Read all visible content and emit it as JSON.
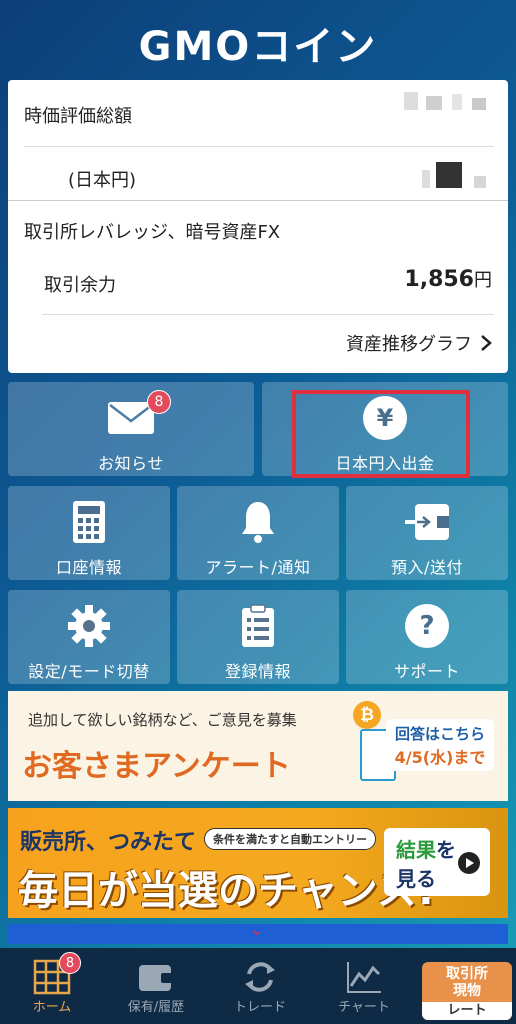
{
  "header": {
    "logo_text": "GMOコイン"
  },
  "assets": {
    "total_label": "時価評価総額",
    "jpy_label": "(日本円)",
    "leverage_label": "取引所レバレッジ、暗号資産FX",
    "margin_label": "取引余力",
    "margin_value": "1,856",
    "margin_unit": "円",
    "graph_link": "資産推移グラフ"
  },
  "tiles": {
    "notice": {
      "label": "お知らせ",
      "badge": "8",
      "icon": "envelope-icon"
    },
    "jpy_deposit": {
      "label": "日本円入出金",
      "icon_glyph": "¥",
      "icon": "yen-icon"
    },
    "account": {
      "label": "口座情報",
      "icon": "calculator-icon"
    },
    "alert": {
      "label": "アラート/通知",
      "icon": "bell-icon"
    },
    "transfer": {
      "label": "預入/送付",
      "icon": "wallet-transfer-icon"
    },
    "settings": {
      "label": "設定/モード切替",
      "icon": "gear-icon"
    },
    "registration": {
      "label": "登録情報",
      "icon": "clipboard-list-icon"
    },
    "support": {
      "label": "サポート",
      "icon_glyph": "?",
      "icon": "question-icon"
    }
  },
  "banner_survey": {
    "top_text": "追加して欲しい銘柄など、ご意見を募集",
    "headline": "お客さまアンケート",
    "answer_line1": "回答はこちら",
    "answer_date": "4/5(水)まで",
    "coin_glyph": "₿"
  },
  "banner_campaign": {
    "line1": "販売所、つみたて",
    "pill": "条件を満たすと自動エントリー",
    "line2": "毎日が当選のチャンス!",
    "result_1": "結果",
    "result_2": "を",
    "result_3": "見る"
  },
  "tabbar": {
    "home": {
      "label": "ホーム",
      "badge": "8"
    },
    "holdings": {
      "label": "保有/履歴"
    },
    "trade": {
      "label": "トレード"
    },
    "chart": {
      "label": "チャート"
    },
    "rate_top": "取引所\n現物",
    "rate_top_1": "取引所",
    "rate_top_2": "現物",
    "rate_bottom": "レート"
  },
  "colors": {
    "accent": "#e8a64a",
    "badge": "#e34a5c",
    "highlight": "#e0303f"
  }
}
